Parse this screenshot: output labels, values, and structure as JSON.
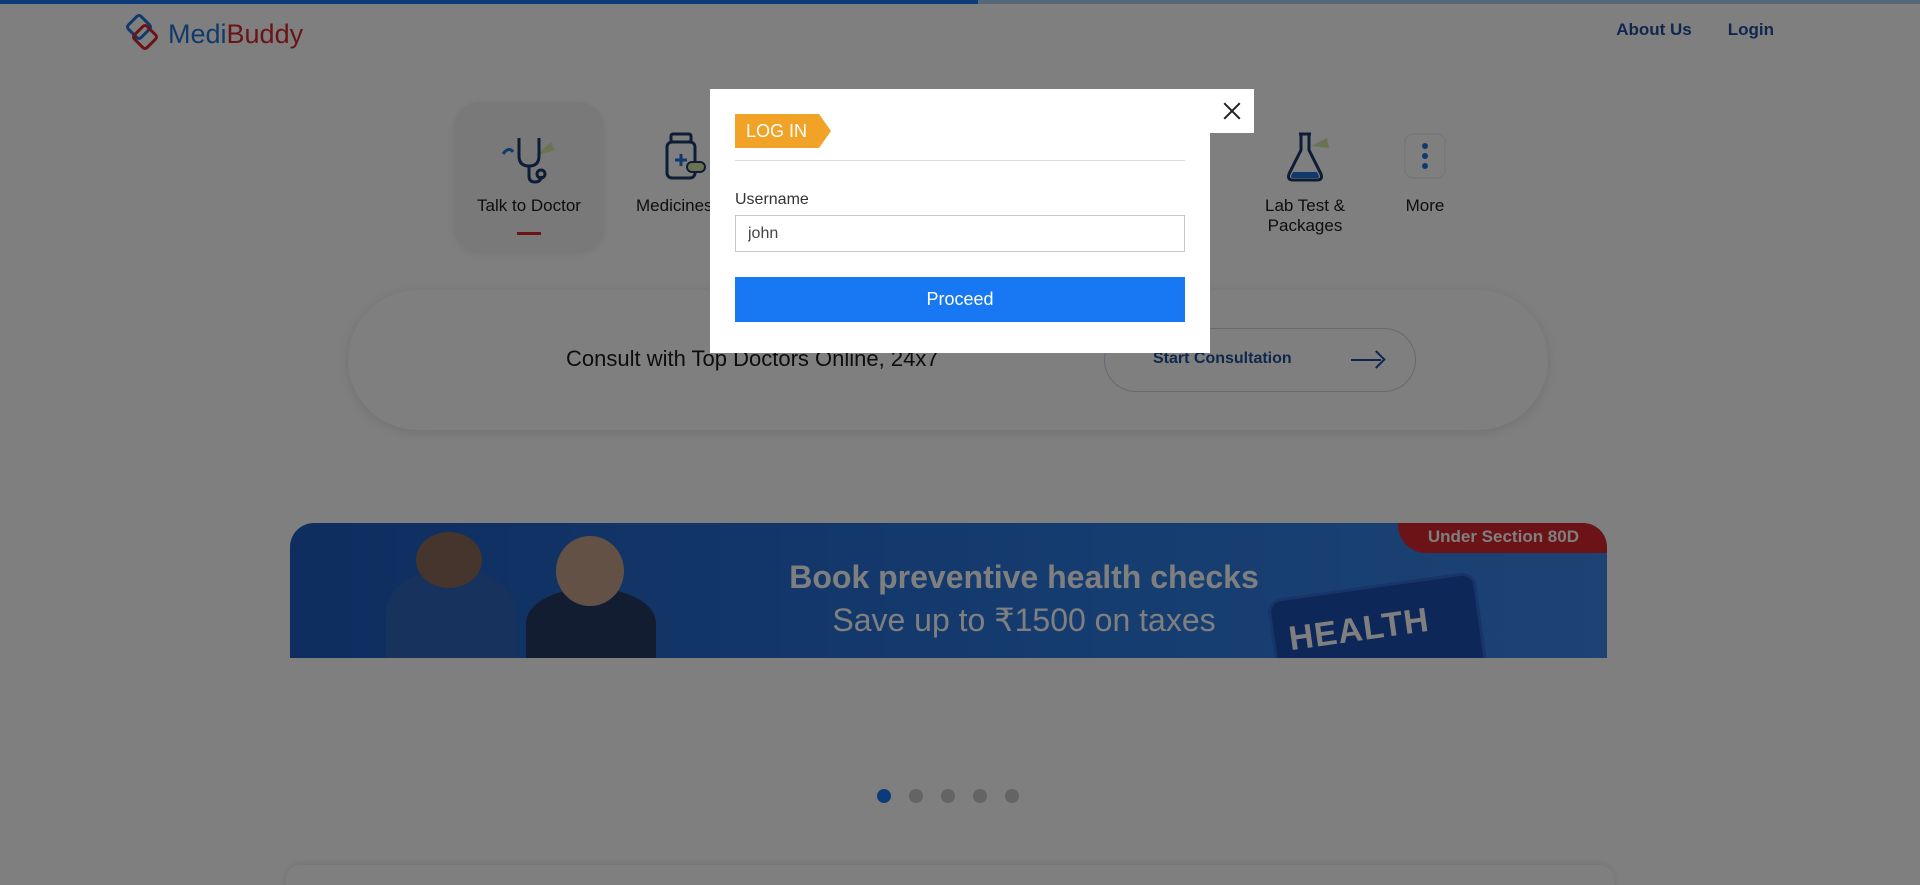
{
  "header": {
    "logo_medi": "Medi",
    "logo_buddy": "Buddy",
    "nav": {
      "about": "About Us",
      "login": "Login"
    }
  },
  "progress_fraction": 0.51,
  "categories": [
    {
      "label": "Talk to Doctor",
      "icon": "stethoscope-icon",
      "active": true
    },
    {
      "label": "Medicines",
      "icon": "medicine-bottle-icon",
      "active": false
    },
    {
      "label": "Lab Test & Packages",
      "icon": "flask-icon",
      "active": false
    },
    {
      "label": "More",
      "icon": "more-dots-icon",
      "active": false
    }
  ],
  "consult": {
    "text": "Consult with Top Doctors Online, 24x7",
    "button": "Start Consultation"
  },
  "banner": {
    "tag": "Under Section 80D",
    "title": "Book preventive health checks",
    "subtitle": "Save up to ₹1500 on taxes",
    "card_text": "HEALTH"
  },
  "carousel": {
    "count": 5,
    "active_index": 0
  },
  "modal": {
    "title": "LOG IN",
    "username_label": "Username",
    "username_value": "john",
    "proceed": "Proceed"
  },
  "colors": {
    "brand_blue": "#1877f2",
    "brand_red": "#d8262e",
    "login_tag": "#f0a326",
    "nav_link": "#1f4e99"
  }
}
